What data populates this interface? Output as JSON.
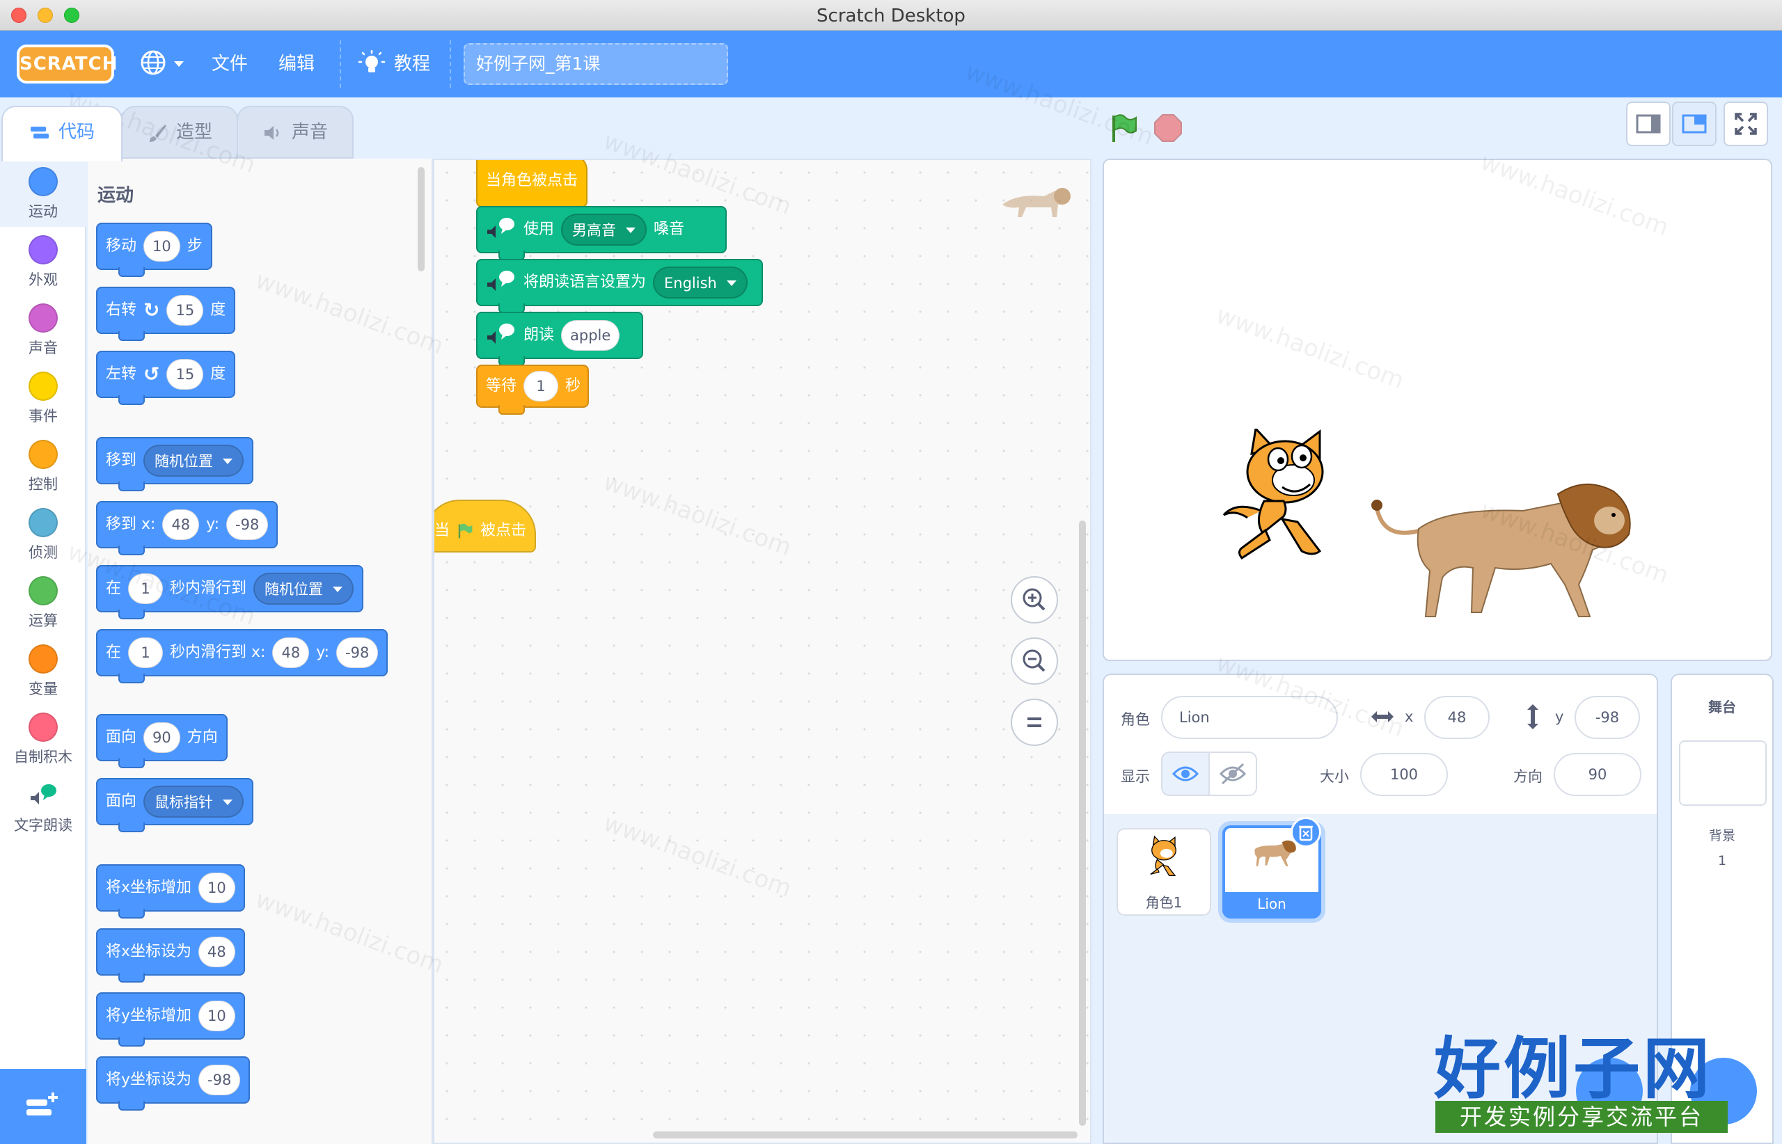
{
  "window": {
    "title": "Scratch Desktop"
  },
  "menubar": {
    "logo": "SCRATCH",
    "file": "文件",
    "edit": "编辑",
    "tutorials": "教程",
    "project_title": "好例子网_第1课"
  },
  "tabs": {
    "code": "代码",
    "costumes": "造型",
    "sounds": "声音"
  },
  "categories": [
    {
      "label": "运动",
      "color": "#4c97ff"
    },
    {
      "label": "外观",
      "color": "#9966ff"
    },
    {
      "label": "声音",
      "color": "#cf63cf"
    },
    {
      "label": "事件",
      "color": "#ffd500"
    },
    {
      "label": "控制",
      "color": "#ffab19"
    },
    {
      "label": "侦测",
      "color": "#5cb1d6"
    },
    {
      "label": "运算",
      "color": "#59c059"
    },
    {
      "label": "变量",
      "color": "#ff8c1a"
    },
    {
      "label": "自制积木",
      "color": "#ff6680"
    },
    {
      "label": "文字朗读",
      "color": "#0fbd8c"
    }
  ],
  "palette": {
    "heading": "运动",
    "move": {
      "a": "移动",
      "v": "10",
      "b": "步"
    },
    "turn_right": {
      "a": "右转",
      "v": "15",
      "b": "度"
    },
    "turn_left": {
      "a": "左转",
      "v": "15",
      "b": "度"
    },
    "goto": {
      "a": "移到",
      "d": "随机位置"
    },
    "goto_xy": {
      "a": "移到 x:",
      "x": "48",
      "b": "y:",
      "y": "-98"
    },
    "glide": {
      "a": "在",
      "v": "1",
      "b": "秒内滑行到",
      "d": "随机位置"
    },
    "glide_xy": {
      "a": "在",
      "v": "1",
      "b": "秒内滑行到 x:",
      "x": "48",
      "c": "y:",
      "y": "-98"
    },
    "point_dir": {
      "a": "面向",
      "v": "90",
      "b": "方向"
    },
    "point_towards": {
      "a": "面向",
      "d": "鼠标指针"
    },
    "change_x": {
      "a": "将x坐标增加",
      "v": "10"
    },
    "set_x": {
      "a": "将x坐标设为",
      "v": "48"
    },
    "change_y": {
      "a": "将y坐标增加",
      "v": "10"
    },
    "set_y": {
      "a": "将y坐标设为",
      "v": "-98"
    }
  },
  "script": {
    "hat": "当角色被点击",
    "voice": {
      "a": "使用",
      "d": "男高音",
      "b": "嗓音"
    },
    "lang": {
      "a": "将朗读语言设置为",
      "d": "English"
    },
    "speak": {
      "a": "朗读",
      "v": "apple"
    },
    "wait": {
      "a": "等待",
      "v": "1",
      "b": "秒"
    },
    "flag_hat": {
      "a": "当",
      "b": "被点击"
    }
  },
  "sprite_info": {
    "sprite_label": "角色",
    "sprite_name": "Lion",
    "x_label": "x",
    "x": "48",
    "y_label": "y",
    "y": "-98",
    "show_label": "显示",
    "size_label": "大小",
    "size": "100",
    "direction_label": "方向",
    "direction": "90"
  },
  "sprites": [
    {
      "name": "角色1"
    },
    {
      "name": "Lion"
    }
  ],
  "stage_pane": {
    "title": "舞台",
    "backdrops_label": "背景",
    "backdrops_count": "1"
  },
  "watermark": "www.haolizi.com",
  "brand": {
    "name": "好例子网",
    "tagline": "开发实例分享交流平台"
  }
}
